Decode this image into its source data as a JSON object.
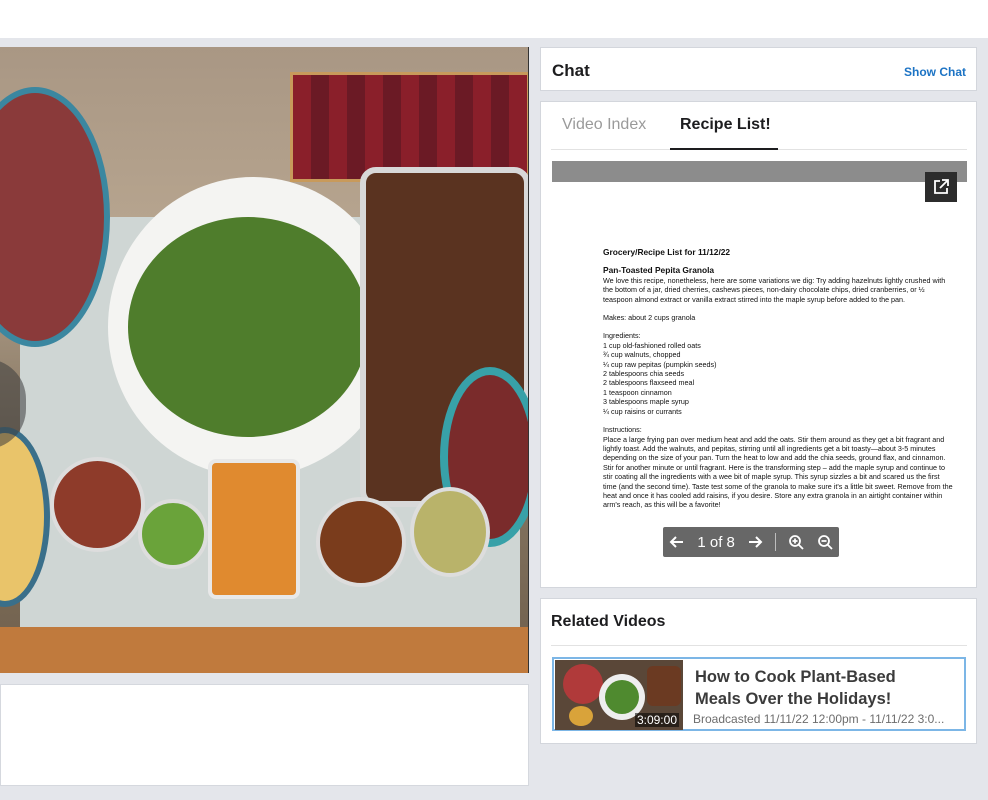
{
  "chat": {
    "title": "Chat",
    "show_label": "Show Chat"
  },
  "tabs": [
    {
      "label": "Video Index",
      "active": false
    },
    {
      "label": "Recipe List!",
      "active": true
    }
  ],
  "document": {
    "heading": "Grocery/Recipe List for 11/12/22",
    "recipe_title": "Pan-Toasted Pepita Granola",
    "intro": "We love this recipe, nonetheless, here are some variations we dig: Try adding hazelnuts lightly crushed with the bottom of a jar, dried cherries, cashews pieces, non-dairy chocolate chips, dried cranberries, or  ½ teaspoon almond extract or vanilla extract stirred into the maple syrup before added to the pan.",
    "makes": "Makes: about 2 cups granola",
    "ingredients_label": "Ingredients:",
    "ingredients": [
      "1 cup old-fashioned rolled oats",
      "¾ cup walnuts, chopped",
      "¼ cup raw pepitas (pumpkin seeds)",
      "2 tablespoons chia seeds",
      "2 tablespoons flaxseed meal",
      "1 teaspoon cinnamon",
      "3 tablespoons maple syrup",
      "¼ cup raisins or currants"
    ],
    "instructions_label": "Instructions:",
    "instructions": "Place a large frying pan over medium heat and add the oats. Stir them around as they get a bit fragrant and lightly toast. Add the walnuts, and pepitas, stirring until all ingredients get a bit toasty—about 3-5 minutes depending on the size of your pan. Turn the heat to low and add the chia seeds, ground flax, and cinnamon. Stir for another minute or until fragrant. Here is the transforming step – add the maple syrup and continue to stir coating all the ingredients with a wee bit of maple syrup. This syrup sizzles a bit and scared us the first time (and the second time). Taste test some of the granola to make sure it's a little bit sweet. Remove from the heat and once it has cooled add raisins, if you desire. Store any extra granola in an airtight container within arm's reach, as this will be a favorite!"
  },
  "pager": {
    "page_text": "1 of 8"
  },
  "related": {
    "title": "Related Videos",
    "items": [
      {
        "title": "How to Cook Plant-Based Meals Over the Holidays!",
        "duration": "3:09:00",
        "meta": "Broadcasted 11/11/22 12:00pm - 11/11/22 3:0..."
      }
    ]
  },
  "icons": {
    "popout": "external-link-icon",
    "prev": "arrow-left-icon",
    "next": "arrow-right-icon",
    "zoom_in": "zoom-in-icon",
    "zoom_out": "zoom-out-icon"
  },
  "colors": {
    "link": "#1c73c4",
    "selected_border": "#7cb6e6",
    "doc_bar": "#8c8c8c"
  }
}
